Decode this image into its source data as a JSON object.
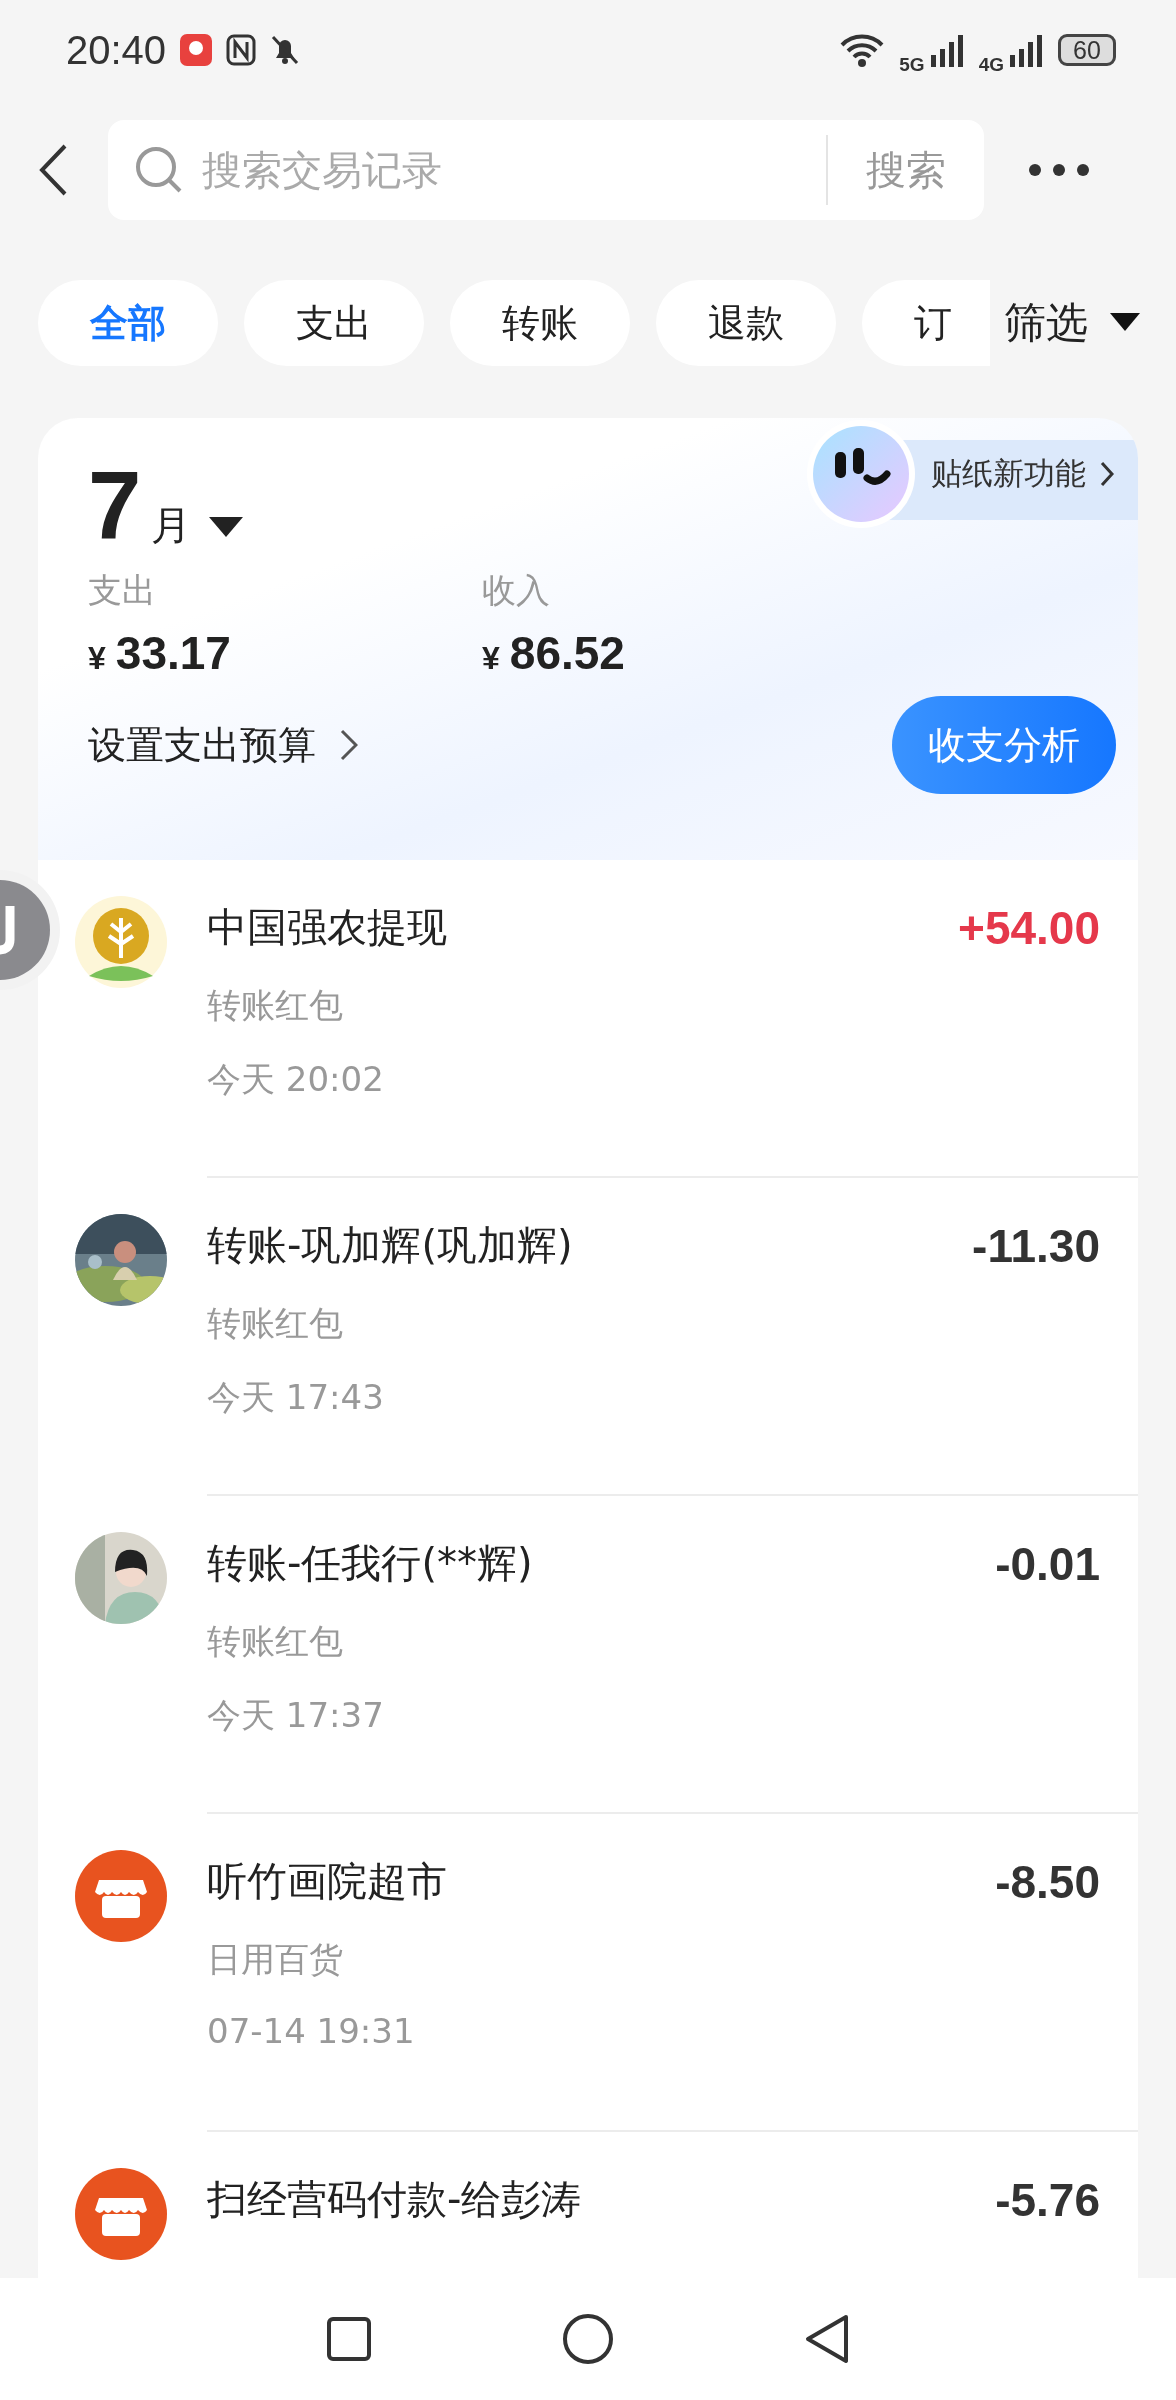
{
  "status_bar": {
    "time": "20:40",
    "network_1": "5G",
    "network_2": "4G",
    "battery": "60"
  },
  "search": {
    "placeholder": "搜索交易记录",
    "button": "搜索"
  },
  "tabs": [
    {
      "label": "全部",
      "selected": true
    },
    {
      "label": "支出",
      "selected": false
    },
    {
      "label": "转账",
      "selected": false
    },
    {
      "label": "退款",
      "selected": false
    },
    {
      "label": "订",
      "selected": false
    }
  ],
  "filter": {
    "label": "筛选"
  },
  "summary": {
    "month": "7",
    "month_unit": "月",
    "sticker_promo": "贴纸新功能",
    "stats": [
      {
        "label": "支出",
        "currency": "¥",
        "amount": "33.17"
      },
      {
        "label": "收入",
        "currency": "¥",
        "amount": "86.52"
      }
    ],
    "budget_link": "设置支出预算",
    "analysis_button": "收支分析"
  },
  "transactions": [
    {
      "kind": "logo",
      "title": "中国强农提现",
      "category": "转账红包",
      "time": "今天 20:02",
      "amount": "+54.00",
      "income": true
    },
    {
      "kind": "picture",
      "title": "转账-巩加辉(巩加辉)",
      "category": "转账红包",
      "time": "今天 17:43",
      "amount": "-11.30",
      "income": false
    },
    {
      "kind": "picture",
      "title": "转账-任我行(**辉)",
      "category": "转账红包",
      "time": "今天 17:37",
      "amount": "-0.01",
      "income": false
    },
    {
      "kind": "store",
      "title": "听竹画院超市",
      "category": "日用百货",
      "time": "07-14 19:31",
      "amount": "-8.50",
      "income": false
    },
    {
      "kind": "store",
      "title": "扫经营码付款-给彭涛",
      "amount": "-5.76",
      "income": false
    }
  ]
}
